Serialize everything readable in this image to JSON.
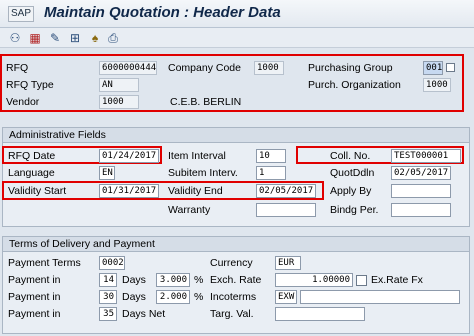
{
  "header": {
    "sap_menu": "SAP",
    "title": "Maintain Quotation : Header Data"
  },
  "toolbar_icons": [
    "org-data-icon",
    "vendor-address-icon",
    "texts-icon",
    "partners-icon",
    "statuses-icon",
    "print-icon"
  ],
  "top": {
    "rfq_label": "RFQ",
    "rfq_value": "6000000444",
    "rfq_type_label": "RFQ Type",
    "rfq_type_value": "AN",
    "vendor_label": "Vendor",
    "vendor_value": "1000",
    "vendor_name": "C.E.B. BERLIN",
    "company_code_label": "Company Code",
    "company_code_value": "1000",
    "purch_group_label": "Purchasing Group",
    "purch_group_value": "001",
    "purch_org_label": "Purch. Organization",
    "purch_org_value": "1000"
  },
  "admin": {
    "title": "Administrative Fields",
    "rfq_date_label": "RFQ Date",
    "rfq_date_value": "01/24/2017",
    "language_label": "Language",
    "language_value": "EN",
    "validity_start_label": "Validity Start",
    "validity_start_value": "01/31/2017",
    "item_interval_label": "Item Interval",
    "item_interval_value": "10",
    "subitem_interv_label": "Subitem Interv.",
    "subitem_interv_value": "1",
    "validity_end_label": "Validity End",
    "validity_end_value": "02/05/2017",
    "warranty_label": "Warranty",
    "coll_no_label": "Coll. No.",
    "coll_no_value": "TEST000001",
    "quotddln_label": "QuotDdln",
    "quotddln_value": "02/05/2017",
    "apply_by_label": "Apply By",
    "bindg_per_label": "Bindg Per."
  },
  "terms": {
    "title": "Terms of Delivery and Payment",
    "payment_terms_label": "Payment Terms",
    "payment_terms_value": "0002",
    "payment_in_label": "Payment in",
    "days_label": "Days",
    "days_net_label": "Days Net",
    "row1_days": "14",
    "row1_pct": "3.000",
    "row2_days": "30",
    "row2_pct": "2.000",
    "row3_days": "35",
    "percent_sign": "%",
    "currency_label": "Currency",
    "currency_value": "EUR",
    "exch_rate_label": "Exch. Rate",
    "exch_rate_value": "1.00000",
    "exrate_fx_label": "Ex.Rate Fx",
    "incoterms_label": "Incoterms",
    "incoterms_value": "EXW",
    "targ_val_label": "Targ. Val."
  },
  "colors": {
    "highlight": "#e00000",
    "background": "#dfe6ee"
  }
}
